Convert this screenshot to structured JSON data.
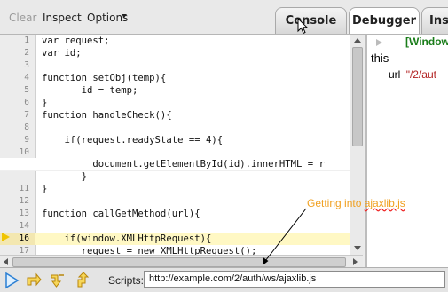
{
  "toolbar": {
    "clear_label": "Clear",
    "inspect_label": "Inspect",
    "options_label": "Options"
  },
  "tabs": [
    {
      "label": "Console",
      "active": false
    },
    {
      "label": "Debugger",
      "active": true
    },
    {
      "label": "Insp",
      "active": false
    }
  ],
  "source": {
    "current_line": 16,
    "lines": [
      {
        "num": "1",
        "code": "var request;"
      },
      {
        "num": "2",
        "code": "var id;"
      },
      {
        "num": "3",
        "code": ""
      },
      {
        "num": "4",
        "code": "function setObj(temp){"
      },
      {
        "num": "5",
        "code": "       id = temp;"
      },
      {
        "num": "6",
        "code": "}"
      },
      {
        "num": "7",
        "code": "function handleCheck(){"
      },
      {
        "num": "8",
        "code": ""
      },
      {
        "num": "9",
        "code": "    if(request.readyState == 4){"
      },
      {
        "num": "10",
        "code": ""
      },
      {
        "num": "",
        "code": "         document.getElementById(id).innerHTML = r"
      },
      {
        "num": "",
        "code": "       }"
      },
      {
        "num": "11",
        "code": "}"
      },
      {
        "num": "12",
        "code": ""
      },
      {
        "num": "13",
        "code": "function callGetMethod(url){"
      },
      {
        "num": "14",
        "code": ""
      },
      {
        "num": "15",
        "code": ""
      },
      {
        "num": "16",
        "code": "    if(window.XMLHttpRequest){"
      },
      {
        "num": "17",
        "code": "       request = new XMLHttpRequest();"
      }
    ]
  },
  "watch": {
    "scope_label": "[Window",
    "this_label": "this",
    "var_name": "url",
    "var_value": "\"/2/aut"
  },
  "bottombar": {
    "scripts_label": "Scripts:",
    "scripts_value": "http://example.com/2/auth/ws/ajaxlib.js"
  },
  "annotation": {
    "text_plain": "Getting into ",
    "text_underlined": "ajaxlib.js"
  },
  "colors": {
    "current_line_bg": "#fff8c4",
    "scope_green": "#1a7d1a",
    "string_red": "#b22222",
    "annotation_orange": "#f0a020"
  }
}
